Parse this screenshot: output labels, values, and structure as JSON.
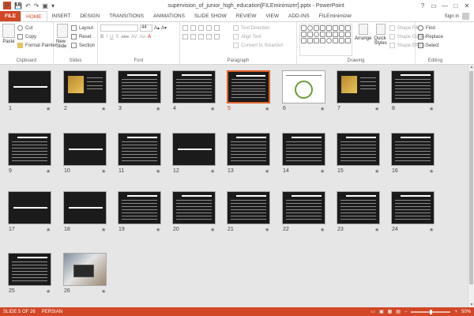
{
  "window": {
    "title": "supervision_of_junior_high_education[FILEminimizer].pptx - PowerPoint",
    "app_logo": "P",
    "controls": [
      "?",
      "▭",
      "—",
      "□",
      "✕"
    ]
  },
  "quick_access": [
    "💾",
    "↶",
    "↷",
    "▣",
    "▾"
  ],
  "tabs": [
    "FILE",
    "HOME",
    "INSERT",
    "DESIGN",
    "TRANSITIONS",
    "ANIMATIONS",
    "SLIDE SHOW",
    "REVIEW",
    "VIEW",
    "ADD-INS",
    "FILEminimizer"
  ],
  "active_tab": "HOME",
  "signin": "Sign in",
  "ribbon": {
    "clipboard": {
      "label": "Clipboard",
      "paste": "Paste",
      "cut": "Cut",
      "copy": "Copy",
      "format_painter": "Format Painter"
    },
    "slides": {
      "label": "Slides",
      "new_slide": "New Slide",
      "layout": "Layout",
      "reset": "Reset",
      "section": "Section"
    },
    "font": {
      "label": "Font",
      "size": "44",
      "buttons": [
        "B",
        "I",
        "U",
        "S",
        "abc",
        "AV",
        "Aa",
        "A"
      ],
      "size_buttons": [
        "A▴",
        "A▾"
      ]
    },
    "paragraph": {
      "label": "Paragraph",
      "text_direction": "Text Direction",
      "align_text": "Align Text",
      "convert_smartart": "Convert to SmartArt"
    },
    "drawing": {
      "label": "Drawing",
      "arrange": "Arrange",
      "quick_styles": "Quick Styles",
      "shape_fill": "Shape Fill",
      "shape_outline": "Shape Outline",
      "shape_effects": "Shape Effects"
    },
    "editing": {
      "label": "Editing",
      "find": "Find",
      "replace": "Replace",
      "select": "Select"
    }
  },
  "slides": [
    {
      "num": "1",
      "star": "★",
      "kind": "title"
    },
    {
      "num": "2",
      "star": "★",
      "kind": "pic"
    },
    {
      "num": "3",
      "star": "★",
      "kind": "text"
    },
    {
      "num": "4",
      "star": "★",
      "kind": "text"
    },
    {
      "num": "5",
      "star": "★",
      "kind": "text"
    },
    {
      "num": "6",
      "star": "★",
      "kind": "white"
    },
    {
      "num": "7",
      "star": "★",
      "kind": "pic"
    },
    {
      "num": "8",
      "star": "★",
      "kind": "text"
    },
    {
      "num": "9",
      "star": "★",
      "kind": "text"
    },
    {
      "num": "10",
      "star": "★",
      "kind": "title"
    },
    {
      "num": "11",
      "star": "★",
      "kind": "text"
    },
    {
      "num": "12",
      "star": "★",
      "kind": "title"
    },
    {
      "num": "13",
      "star": "★",
      "kind": "text"
    },
    {
      "num": "14",
      "star": "★",
      "kind": "text"
    },
    {
      "num": "15",
      "star": "★",
      "kind": "text"
    },
    {
      "num": "16",
      "star": "★",
      "kind": "text"
    },
    {
      "num": "17",
      "star": "★",
      "kind": "title"
    },
    {
      "num": "18",
      "star": "★",
      "kind": "title"
    },
    {
      "num": "19",
      "star": "★",
      "kind": "text"
    },
    {
      "num": "20",
      "star": "★",
      "kind": "text"
    },
    {
      "num": "21",
      "star": "★",
      "kind": "text"
    },
    {
      "num": "22",
      "star": "★",
      "kind": "text"
    },
    {
      "num": "23",
      "star": "★",
      "kind": "text"
    },
    {
      "num": "24",
      "star": "★",
      "kind": "text"
    },
    {
      "num": "25",
      "star": "★",
      "kind": "text"
    },
    {
      "num": "26",
      "star": "★",
      "kind": "photo"
    }
  ],
  "selected_slide": 5,
  "status": {
    "slide": "SLIDE 5 OF 26",
    "language": "PERSIAN",
    "zoom": "50%",
    "zoom_fraction": 0.5
  },
  "colors": {
    "accent": "#d24726",
    "selection": "#e0602a"
  }
}
